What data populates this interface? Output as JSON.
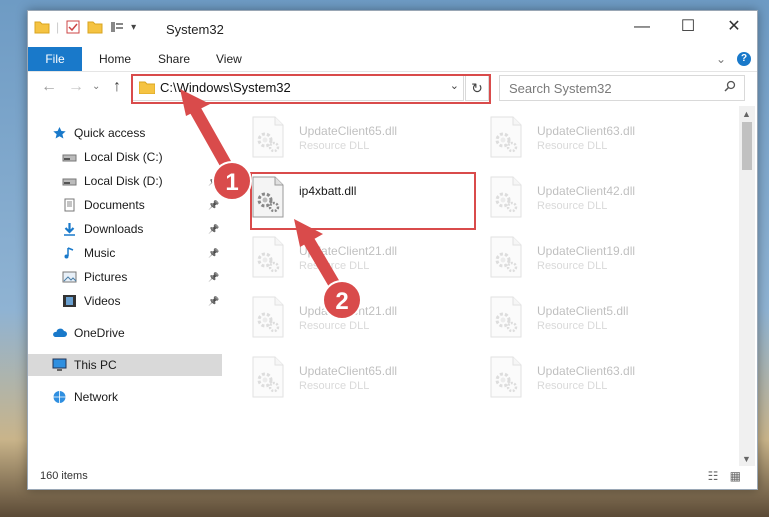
{
  "window": {
    "title": "System32",
    "controls": {
      "minimize": "—",
      "maximize": "☐",
      "close": "✕"
    },
    "help": "?"
  },
  "ribbon": {
    "tabs": [
      "File",
      "Home",
      "Share",
      "View"
    ],
    "expand": "⌄"
  },
  "nav": {
    "back": "←",
    "forward": "→",
    "recent": "⌄",
    "up": "↑",
    "address": "C:\\Windows\\System32",
    "address_dropdown": "⌄",
    "refresh": "↻",
    "search_placeholder": "Search System32",
    "search_icon": "search-icon"
  },
  "sidebar": {
    "items": [
      {
        "label": "Quick access",
        "icon": "star-icon",
        "pinned": false
      },
      {
        "label": "Local Disk (C:)",
        "icon": "drive-icon",
        "pinned": false
      },
      {
        "label": "Local Disk (D:)",
        "icon": "drive-icon",
        "pinned": true
      },
      {
        "label": "Documents",
        "icon": "documents-icon",
        "pinned": true
      },
      {
        "label": "Downloads",
        "icon": "downloads-icon",
        "pinned": true
      },
      {
        "label": "Music",
        "icon": "music-icon",
        "pinned": true
      },
      {
        "label": "Pictures",
        "icon": "pictures-icon",
        "pinned": true
      },
      {
        "label": "Videos",
        "icon": "videos-icon",
        "pinned": true
      },
      {
        "label": "OneDrive",
        "icon": "cloud-icon",
        "pinned": false
      },
      {
        "label": "This PC",
        "icon": "computer-icon",
        "pinned": false,
        "selected": true
      },
      {
        "label": "Network",
        "icon": "network-icon",
        "pinned": false
      }
    ],
    "pin_glyph": "📌"
  },
  "files": {
    "col1": [
      {
        "name": "UpdateClient65.dll",
        "type": "Resource DLL",
        "faded": true
      },
      {
        "name": "ip4xbatt.dll",
        "type": "",
        "faded": false
      },
      {
        "name": "UpdateClient21.dll",
        "type": "Resource DLL",
        "faded": true
      },
      {
        "name": "UpdateClient21.dll",
        "type": "Resource DLL",
        "faded": true
      },
      {
        "name": "UpdateClient65.dll",
        "type": "Resource DLL",
        "faded": true
      }
    ],
    "col2": [
      {
        "name": "UpdateClient63.dll",
        "type": "Resource DLL",
        "faded": true
      },
      {
        "name": "UpdateClient42.dll",
        "type": "Resource DLL",
        "faded": true
      },
      {
        "name": "UpdateClient19.dll",
        "type": "Resource DLL",
        "faded": true
      },
      {
        "name": "UpdateClient5.dll",
        "type": "Resource DLL",
        "faded": true
      },
      {
        "name": "UpdateClient63.dll",
        "type": "Resource DLL",
        "faded": true
      }
    ]
  },
  "status": {
    "item_count": "160 items",
    "views": "☷ ▦"
  },
  "annotations": {
    "step1": "1",
    "step2": "2",
    "color": "#d94b4b"
  }
}
